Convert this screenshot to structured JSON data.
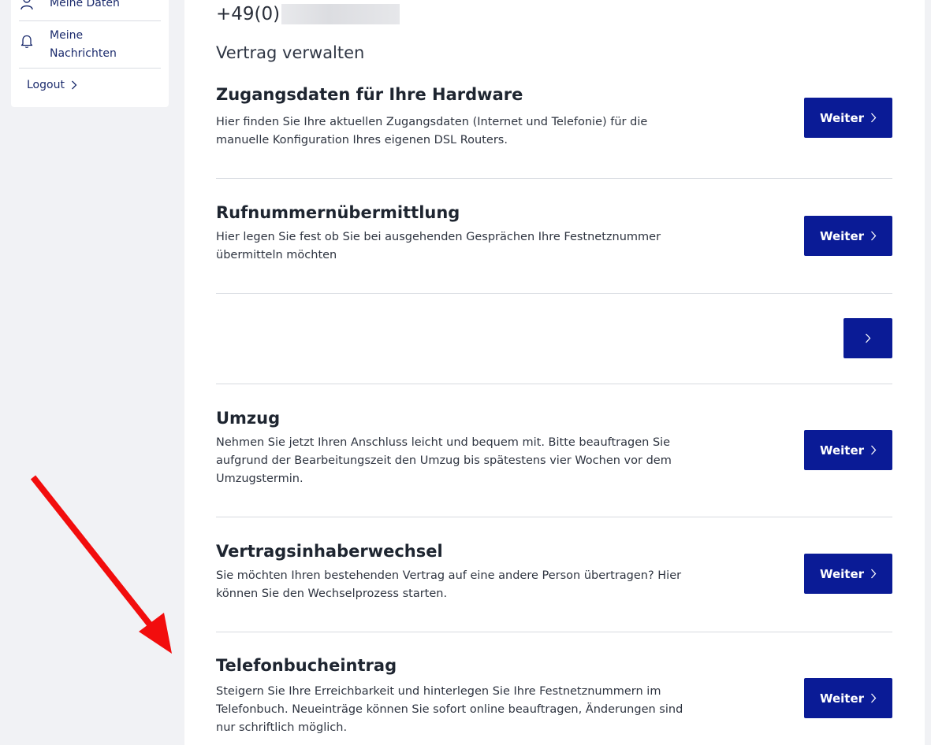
{
  "sidebar": {
    "items": [
      {
        "label": "Meine Daten",
        "icon": "user-icon"
      },
      {
        "label": "Meine\nNachrichten",
        "icon": "bell-icon"
      }
    ],
    "logout_label": "Logout"
  },
  "main": {
    "phone_prefix": "+49(0)",
    "section_title": "Vertrag verwalten",
    "rows": [
      {
        "title": "Zugangsdaten für Ihre Hardware",
        "description": "Hier finden Sie Ihre aktuellen Zugangsdaten (Internet und Telefonie) für die manuelle Konfiguration Ihres eigenen DSL Routers.",
        "button": "Weiter"
      },
      {
        "title": "Rufnummernübermittlung",
        "description": "Hier legen Sie fest ob Sie bei ausgehenden Gesprächen Ihre Festnetznummer übermitteln möchten",
        "button": "Weiter"
      },
      {
        "title": "",
        "description": "",
        "button": ""
      },
      {
        "title": "Umzug",
        "description": "Nehmen Sie jetzt Ihren Anschluss leicht und bequem mit. Bitte beauftragen Sie aufgrund der Bearbeitungszeit den Umzug bis spätestens vier Wochen vor dem Umzugstermin.",
        "button": "Weiter"
      },
      {
        "title": "Vertragsinhaberwechsel",
        "description": "Sie möchten Ihren bestehenden Vertrag auf eine andere Person übertragen? Hier können Sie den Wechselprozess starten.",
        "button": "Weiter"
      },
      {
        "title": "Telefonbucheintrag",
        "description": "Steigern Sie Ihre Erreichbarkeit und hinterlegen Sie Ihre Festnetznummern im Telefonbuch. Neueinträge können Sie sofort online beauftragen, Änderungen sind nur schriftlich möglich.",
        "button": "Weiter"
      }
    ]
  },
  "colors": {
    "primary_button": "#0a1b96",
    "annotation_arrow": "#f20d0d",
    "nav_text": "#1a2a6c"
  }
}
